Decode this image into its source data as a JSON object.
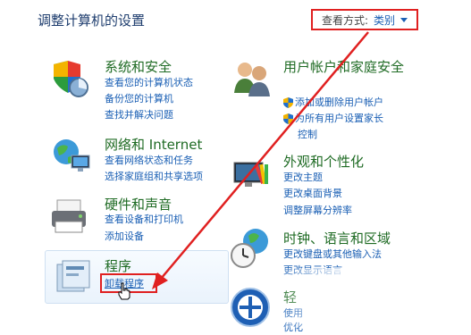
{
  "header": {
    "title": "调整计算机的设置",
    "view_label": "查看方式:",
    "view_value": "类别"
  },
  "left_categories": [
    {
      "title": "系统和安全",
      "links": [
        "查看您的计算机状态",
        "备份您的计算机",
        "查找并解决问题"
      ]
    },
    {
      "title": "网络和 Internet",
      "links": [
        "查看网络状态和任务",
        "选择家庭组和共享选项"
      ]
    },
    {
      "title": "硬件和声音",
      "links": [
        "查看设备和打印机",
        "添加设备"
      ]
    },
    {
      "title": "程序",
      "links": [
        "卸载程序"
      ]
    }
  ],
  "right_categories": [
    {
      "title": "用户帐户和家庭安全",
      "links": [
        "添加或删除用户帐户",
        "为所有用户设置家长",
        "控制"
      ]
    },
    {
      "title": "外观和个性化",
      "links": [
        "更改主题",
        "更改桌面背景",
        "调整屏幕分辨率"
      ]
    },
    {
      "title": "时钟、语言和区域",
      "links": [
        "更改键盘或其他输入法",
        "更改显示语言"
      ]
    },
    {
      "title": "轻",
      "links": [
        "使用",
        "优化"
      ]
    }
  ],
  "colors": {
    "highlight_red": "#e02020",
    "link_blue": "#1a5fb4",
    "category_green": "#1f6b24"
  }
}
